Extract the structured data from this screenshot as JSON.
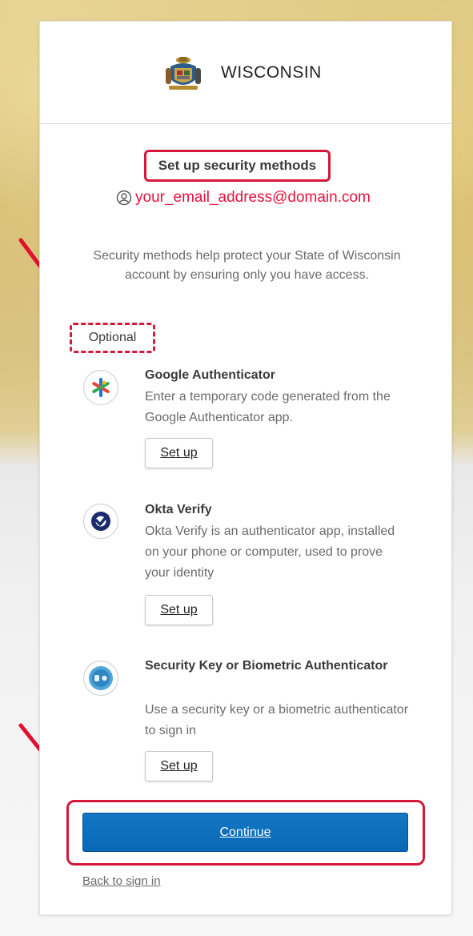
{
  "header": {
    "brand": "WISCONSIN"
  },
  "main": {
    "title": "Set up security methods",
    "email": "your_email_address@domain.com",
    "description": "Security methods help protect your State of Wisconsin account by ensuring only you have access.",
    "optional_label": "Optional"
  },
  "methods": [
    {
      "title": "Google Authenticator",
      "description": "Enter a temporary code generated from the Google Authenticator app.",
      "button": "Set up",
      "icon": "google-authenticator-icon"
    },
    {
      "title": "Okta Verify",
      "description": "Okta Verify is an authenticator app, installed on your phone or computer, used to prove your identity",
      "button": "Set up",
      "icon": "okta-verify-icon"
    },
    {
      "title": "Security Key or Biometric Authenticator",
      "description": "Use a security key or a biometric authenticator to sign in",
      "button": "Set up",
      "icon": "security-key-icon"
    }
  ],
  "footer": {
    "continue_label": "Continue",
    "back_link": "Back to sign in"
  },
  "colors": {
    "highlight": "#d6173a",
    "email": "#e8123c",
    "primary_button": "#0a68b6"
  }
}
